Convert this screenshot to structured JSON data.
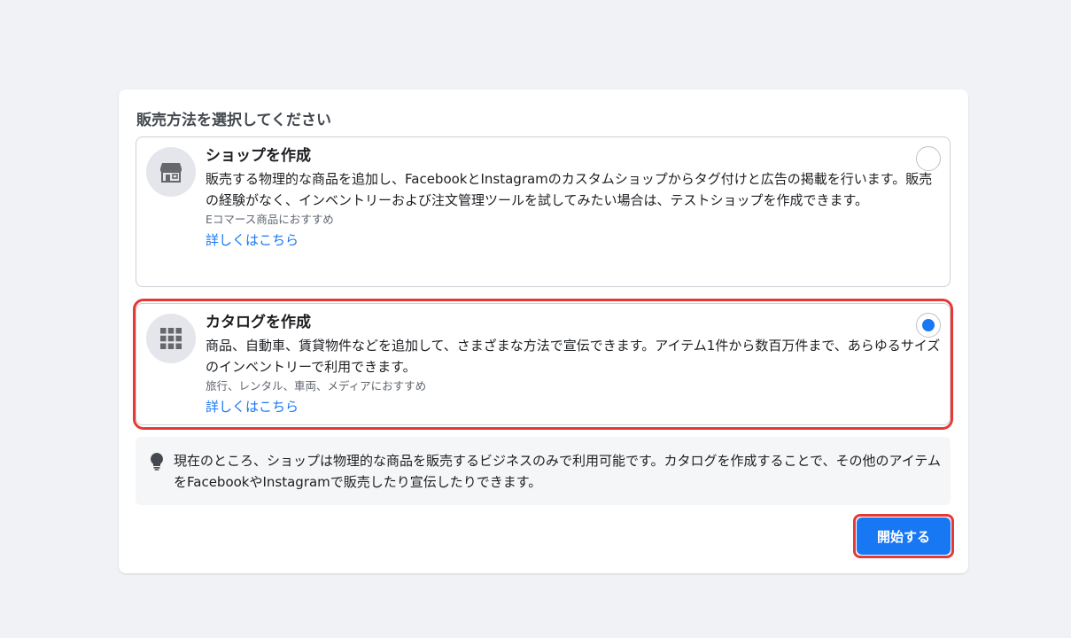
{
  "dialog": {
    "title": "販売方法を選択してください"
  },
  "options": [
    {
      "icon": "storefront-icon",
      "title": "ショップを作成",
      "description": "販売する物理的な商品を追加し、FacebookとInstagramのカスタムショップからタグ付けと広告の掲載を行います。販売の経験がなく、インベントリーおよび注文管理ツールを試してみたい場合は、テストショップを作成できます。",
      "recommend": "Eコマース商品におすすめ",
      "link": "詳しくはこちら",
      "selected": false
    },
    {
      "icon": "grid-icon",
      "title": "カタログを作成",
      "description": "商品、自動車、賃貸物件などを追加して、さまざまな方法で宣伝できます。アイテム1件から数百万件まで、あらゆるサイズのインベントリーで利用できます。",
      "recommend": "旅行、レンタル、車両、メディアにおすすめ",
      "link": "詳しくはこちら",
      "selected": true
    }
  ],
  "notice": {
    "icon": "lightbulb-icon",
    "text": "現在のところ、ショップは物理的な商品を販売するビジネスのみで利用可能です。カタログを作成することで、その他のアイテムをFacebookやInstagramで販売したり宣伝したりできます。"
  },
  "actions": {
    "start_label": "開始する"
  },
  "colors": {
    "accent": "#1877f2",
    "highlight": "#e53935",
    "background": "#f0f2f5"
  }
}
